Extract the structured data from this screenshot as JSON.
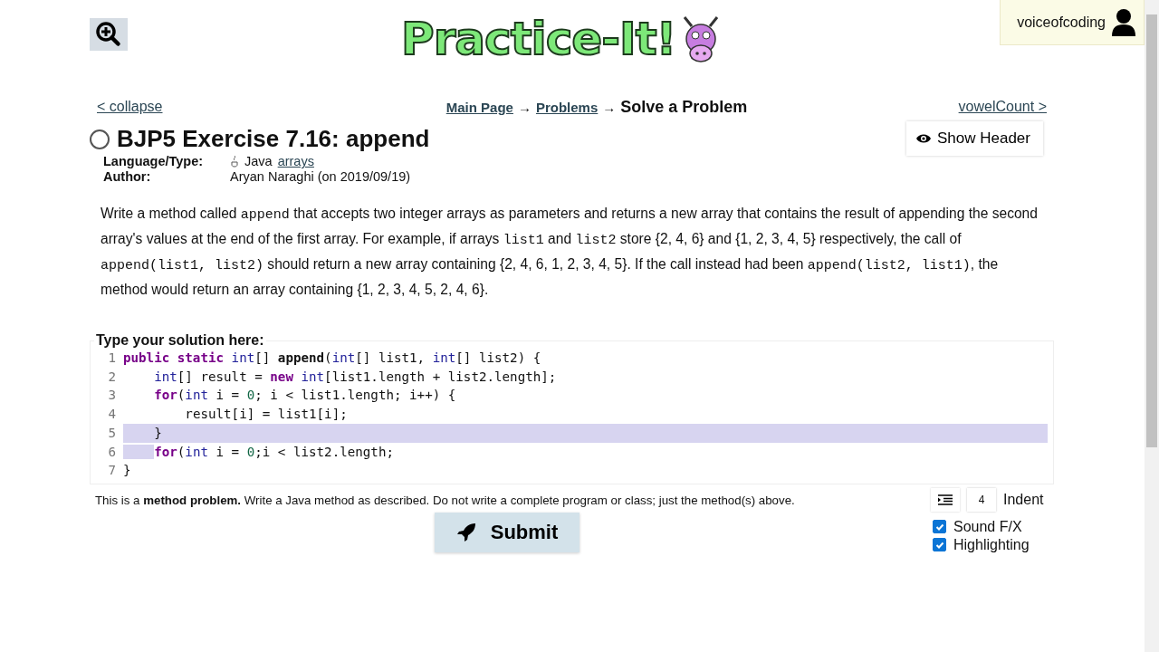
{
  "logo": {
    "text": "Practice-It!"
  },
  "user": {
    "name": "voiceofcoding"
  },
  "nav": {
    "back": "< collapse",
    "next": "vowelCount >",
    "crumbs": [
      {
        "text": "Main Page",
        "link": true
      },
      {
        "text": "→",
        "link": false
      },
      {
        "text": "Problems",
        "link": true
      },
      {
        "text": "→",
        "link": false
      },
      {
        "text": "Solve a Problem",
        "link": false
      }
    ]
  },
  "show_header": "Show Header",
  "problem": {
    "title": "BJP5 Exercise 7.16: append",
    "solved": false,
    "meta": [
      {
        "label": "Language/Type:",
        "value": "Java",
        "link": "arrays"
      },
      {
        "label": "Author:",
        "value": "Aryan Naraghi (on 2019/09/19)"
      }
    ],
    "description": [
      {
        "text": "Write a method called "
      },
      {
        "code": "append"
      },
      {
        "text": " that accepts two integer arrays as parameters and returns a new array that contains the result of appending the second array's values at the end of the first array. For example, if arrays "
      },
      {
        "code": "list1"
      },
      {
        "text": " and "
      },
      {
        "code": "list2"
      },
      {
        "text": " store {2, 4, 6} and {1, 2, 3, 4, 5} respectively, the call of "
      },
      {
        "code": "append(list1, list2)"
      },
      {
        "text": " should return a new array containing {2, 4, 6, 1, 2, 3, 4, 5}. If the call instead had been "
      },
      {
        "code": "append(list2, list1)"
      },
      {
        "text": ", the method would return an array containing {1, 2, 3, 4, 5, 2, 4, 6}."
      }
    ]
  },
  "editor": {
    "legend": "Type your solution here:",
    "lines": [
      {
        "number": "1",
        "active": false,
        "tokens": [
          {
            "text": "public static ",
            "kind": "keyword"
          },
          {
            "text": "int",
            "kind": "type"
          },
          {
            "text": "[] ",
            "kind": "plain"
          },
          {
            "text": "append",
            "kind": "name"
          },
          {
            "text": "(",
            "kind": "plain"
          },
          {
            "text": "int",
            "kind": "type"
          },
          {
            "text": "[] list1, ",
            "kind": "plain"
          },
          {
            "text": "int",
            "kind": "type"
          },
          {
            "text": "[] list2) {",
            "kind": "plain"
          }
        ]
      },
      {
        "number": "2",
        "active": false,
        "indent_selected": false,
        "tokens": [
          {
            "text": "    int",
            "kind": "type"
          },
          {
            "text": "[] result = ",
            "kind": "plain"
          },
          {
            "text": "new ",
            "kind": "keyword"
          },
          {
            "text": "int",
            "kind": "type"
          },
          {
            "text": "[list1.length + list2.length];",
            "kind": "plain"
          }
        ]
      },
      {
        "number": "3",
        "active": false,
        "indent_selected": false,
        "tokens": [
          {
            "text": "    for",
            "kind": "keyword"
          },
          {
            "text": "(",
            "kind": "plain"
          },
          {
            "text": "int",
            "kind": "type"
          },
          {
            "text": " i = ",
            "kind": "plain"
          },
          {
            "text": "0",
            "kind": "number"
          },
          {
            "text": "; i < list1.length; i++) {",
            "kind": "plain"
          }
        ]
      },
      {
        "number": "4",
        "active": false,
        "indent_selected": false,
        "tokens": [
          {
            "text": "        result[i] = list1[i];",
            "kind": "plain"
          }
        ]
      },
      {
        "number": "5",
        "active": true,
        "indent_selected": false,
        "tokens": [
          {
            "text": "    }",
            "kind": "plain"
          }
        ]
      },
      {
        "number": "6",
        "active": false,
        "indent_selected": true,
        "tokens": [
          {
            "text": "    for",
            "kind": "keyword"
          },
          {
            "text": "(",
            "kind": "plain"
          },
          {
            "text": "int",
            "kind": "type"
          },
          {
            "text": " i = ",
            "kind": "plain"
          },
          {
            "text": "0",
            "kind": "number"
          },
          {
            "text": ";i < list2.length;",
            "kind": "plain"
          }
        ]
      },
      {
        "number": "7",
        "active": false,
        "tokens": [
          {
            "text": "}",
            "kind": "plain"
          }
        ]
      }
    ]
  },
  "hint": "This is a **method problem.** Write a Java method as described. Do not write a complete program or class; just the method(s) above.",
  "submit": "Submit",
  "indent": {
    "value": "4",
    "label": "Indent"
  },
  "options": [
    {
      "label": "Sound F/X",
      "checked": true
    },
    {
      "label": "Highlighting",
      "checked": true
    }
  ]
}
